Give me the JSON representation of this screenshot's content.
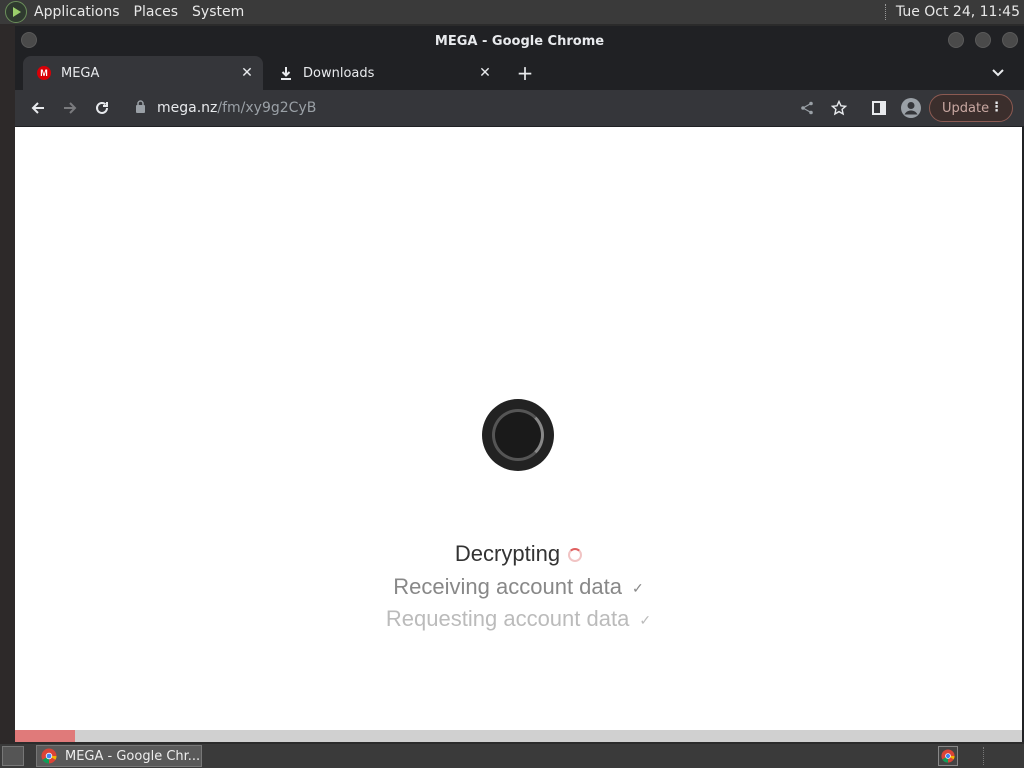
{
  "system_panel": {
    "menus": [
      "Applications",
      "Places",
      "System"
    ],
    "clock": "Tue Oct 24, 11:45"
  },
  "window": {
    "title": "MEGA - Google Chrome"
  },
  "tabs": [
    {
      "label": "MEGA",
      "icon": "mega-logo-icon",
      "active": true
    },
    {
      "label": "Downloads",
      "icon": "download-icon",
      "active": false
    }
  ],
  "toolbar": {
    "url_domain": "mega.nz",
    "url_path": "/fm/xy9g2CyB",
    "update_label": "Update"
  },
  "page": {
    "status_current": "Decrypting",
    "status_done_1": "Receiving account data",
    "status_done_2": "Requesting account data",
    "check_mark": "✓",
    "progress_fraction": 0.06,
    "accent_color": "#d90007"
  },
  "taskbar": {
    "item_label": "MEGA - Google Chr..."
  }
}
